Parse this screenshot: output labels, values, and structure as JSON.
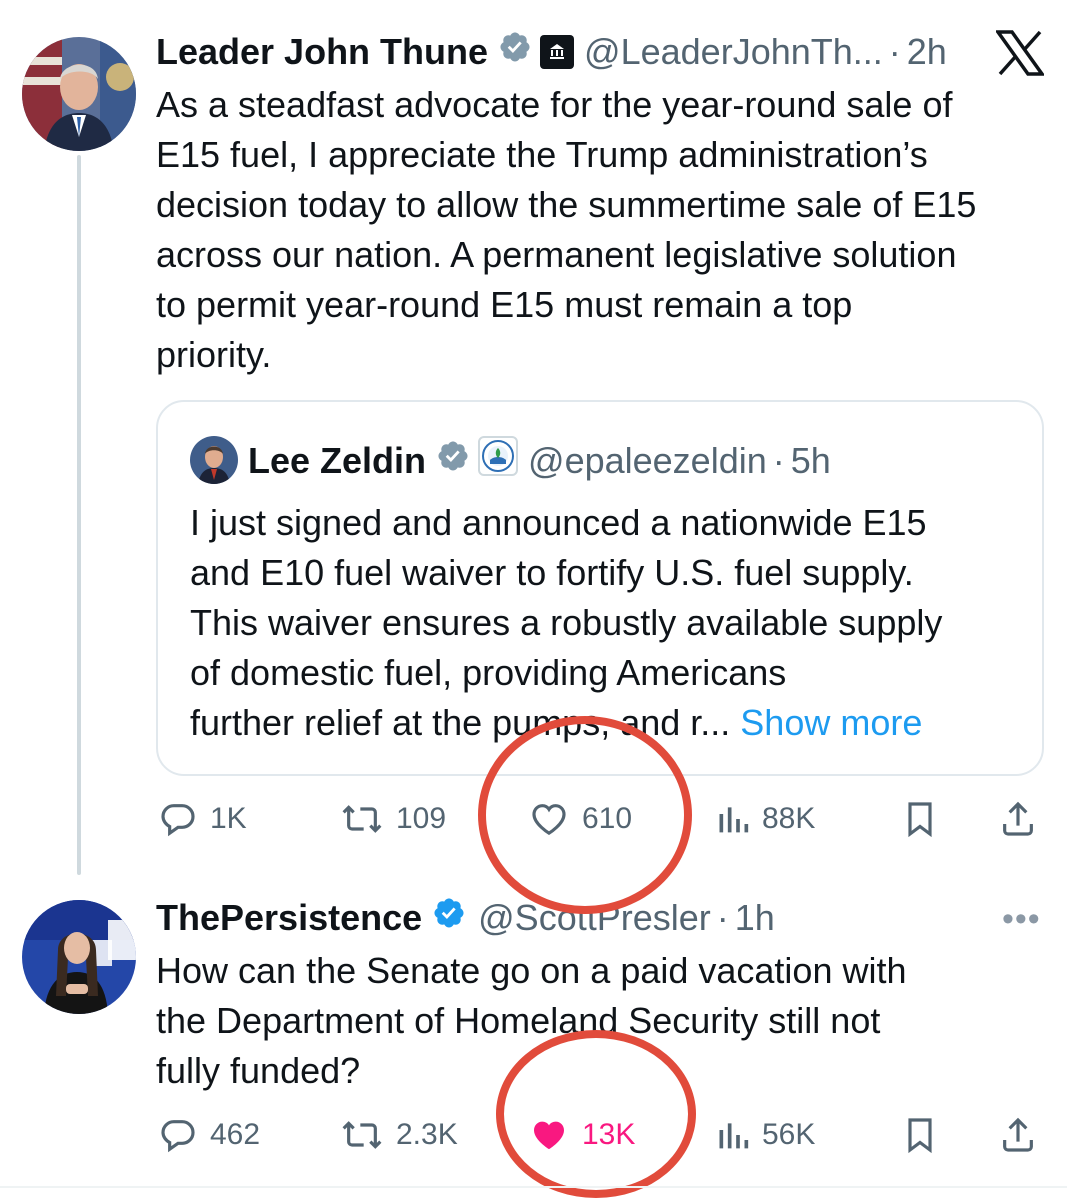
{
  "tweet1": {
    "display_name": "Leader John Thune",
    "handle": "@LeaderJohnTh...",
    "time": "2h",
    "separator": "·",
    "text": "As a steadfast advocate for the year-round sale of\nE15 fuel, I appreciate the Trump administration’s\ndecision today to allow the summertime sale of E15\nacross our nation. A permanent legislative solution\nto permit year-round E15 must remain a top\npriority.",
    "quote": {
      "display_name": "Lee Zeldin",
      "handle": "@epaleezeldin",
      "time": "5h",
      "separator": "·",
      "text": "I just signed and announced a nationwide E15\nand E10 fuel waiver to fortify U.S. fuel supply.\nThis waiver ensures a robustly available supply\nof domestic fuel, providing Americans\nfurther relief at the pumps, and r... ",
      "show_more": "Show more"
    },
    "actions": {
      "replies": "1K",
      "reposts": "109",
      "likes": "610",
      "views": "88K"
    }
  },
  "tweet2": {
    "display_name": "ThePersistence",
    "handle": "@ScottPresler",
    "time": "1h",
    "separator": "·",
    "text": "How can the Senate go on a paid vacation with\nthe Department of Homeland Security still not\nfully funded?",
    "more": "•••",
    "actions": {
      "replies": "462",
      "reposts": "2.3K",
      "likes": "13K",
      "views": "56K",
      "liked": true
    }
  },
  "colors": {
    "text": "#0f1419",
    "secondary": "#536471",
    "link": "#1d9bf0",
    "like_active": "#f91880",
    "verified": "#829aab",
    "verified_blue": "#1d9bf0",
    "annotation_circle": "#e14b3b"
  },
  "icons": {
    "reply": "reply-icon",
    "repost": "repost-icon",
    "like": "heart-icon",
    "views": "views-icon",
    "bookmark": "bookmark-icon",
    "share": "share-icon",
    "verified": "verified-badge-icon",
    "platform": "x-logo-icon"
  }
}
